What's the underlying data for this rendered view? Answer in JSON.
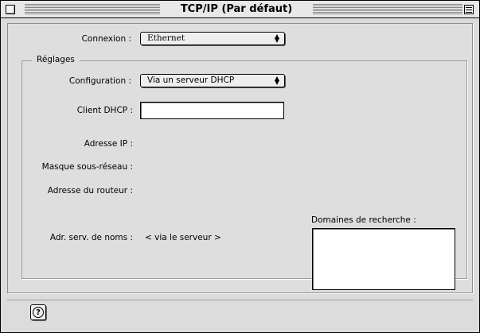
{
  "window": {
    "title": "TCP/IP (Par défaut)",
    "close_icon": "close-box-icon",
    "zoom_icon": "zoom-box-icon"
  },
  "connexion": {
    "label": "Connexion :",
    "value": "Ethernet"
  },
  "reglages": {
    "title": "Réglages",
    "configuration_label": "Configuration :",
    "configuration_value": "Via un serveur DHCP",
    "client_dhcp_label": "Client DHCP :",
    "client_dhcp_value": "",
    "ip_label": "Adresse IP :",
    "mask_label": "Masque sous-réseau :",
    "router_label": "Adresse du routeur :",
    "dns_label": "Adr. serv. de noms :",
    "dns_value": "< via le serveur >",
    "domains_label": "Domaines de recherche :",
    "domains_value": ""
  },
  "footer": {
    "help_icon": "help-icon",
    "help_glyph": "?"
  },
  "colors": {
    "window_bg": "#dcdcdc",
    "field_bg": "#ffffff",
    "border": "#000000"
  }
}
